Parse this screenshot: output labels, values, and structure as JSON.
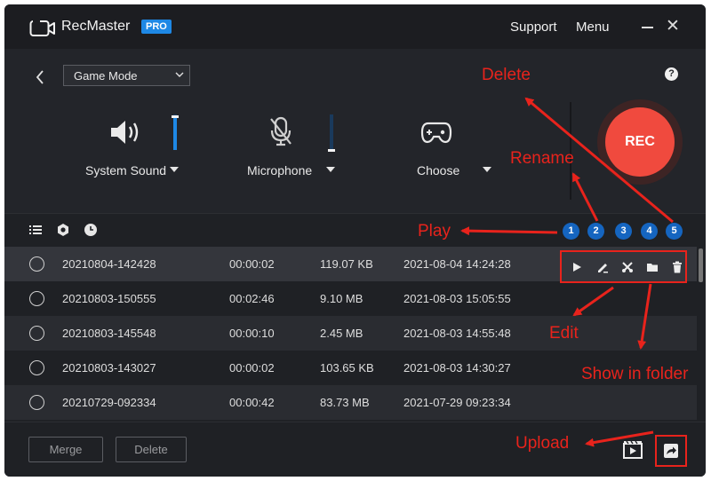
{
  "app": {
    "title": "RecMaster",
    "badge": "PRO"
  },
  "titlebar": {
    "support": "Support",
    "menu": "Menu",
    "close": "✕"
  },
  "controls": {
    "mode": "Game Mode",
    "help": "?",
    "sources": [
      {
        "label": "System Sound",
        "level": 0.95
      },
      {
        "label": "Microphone",
        "level": 0.0
      },
      {
        "label": "Choose"
      }
    ],
    "rec_label": "REC"
  },
  "list": {
    "rows": [
      {
        "name": "20210804-142428",
        "duration": "00:00:02",
        "size": "119.07 KB",
        "date": "2021-08-04 14:24:28"
      },
      {
        "name": "20210803-150555",
        "duration": "00:02:46",
        "size": "9.10 MB",
        "date": "2021-08-03 15:05:55"
      },
      {
        "name": "20210803-145548",
        "duration": "00:00:10",
        "size": "2.45 MB",
        "date": "2021-08-03 14:55:48"
      },
      {
        "name": "20210803-143027",
        "duration": "00:00:02",
        "size": "103.65 KB",
        "date": "2021-08-03 14:30:27"
      },
      {
        "name": "20210729-092334",
        "duration": "00:00:42",
        "size": "83.73 MB",
        "date": "2021-07-29 09:23:34"
      }
    ]
  },
  "footer": {
    "merge": "Merge",
    "delete": "Delete"
  },
  "annotations": {
    "delete": "Delete",
    "rename": "Rename",
    "play": "Play",
    "edit": "Edit",
    "show_in_folder": "Show in folder",
    "upload": "Upload",
    "numbers": [
      "1",
      "2",
      "3",
      "4",
      "5"
    ]
  },
  "colors": {
    "accent": "#1e88e5",
    "rec": "#f04a3e",
    "annotation": "#e8231c"
  }
}
